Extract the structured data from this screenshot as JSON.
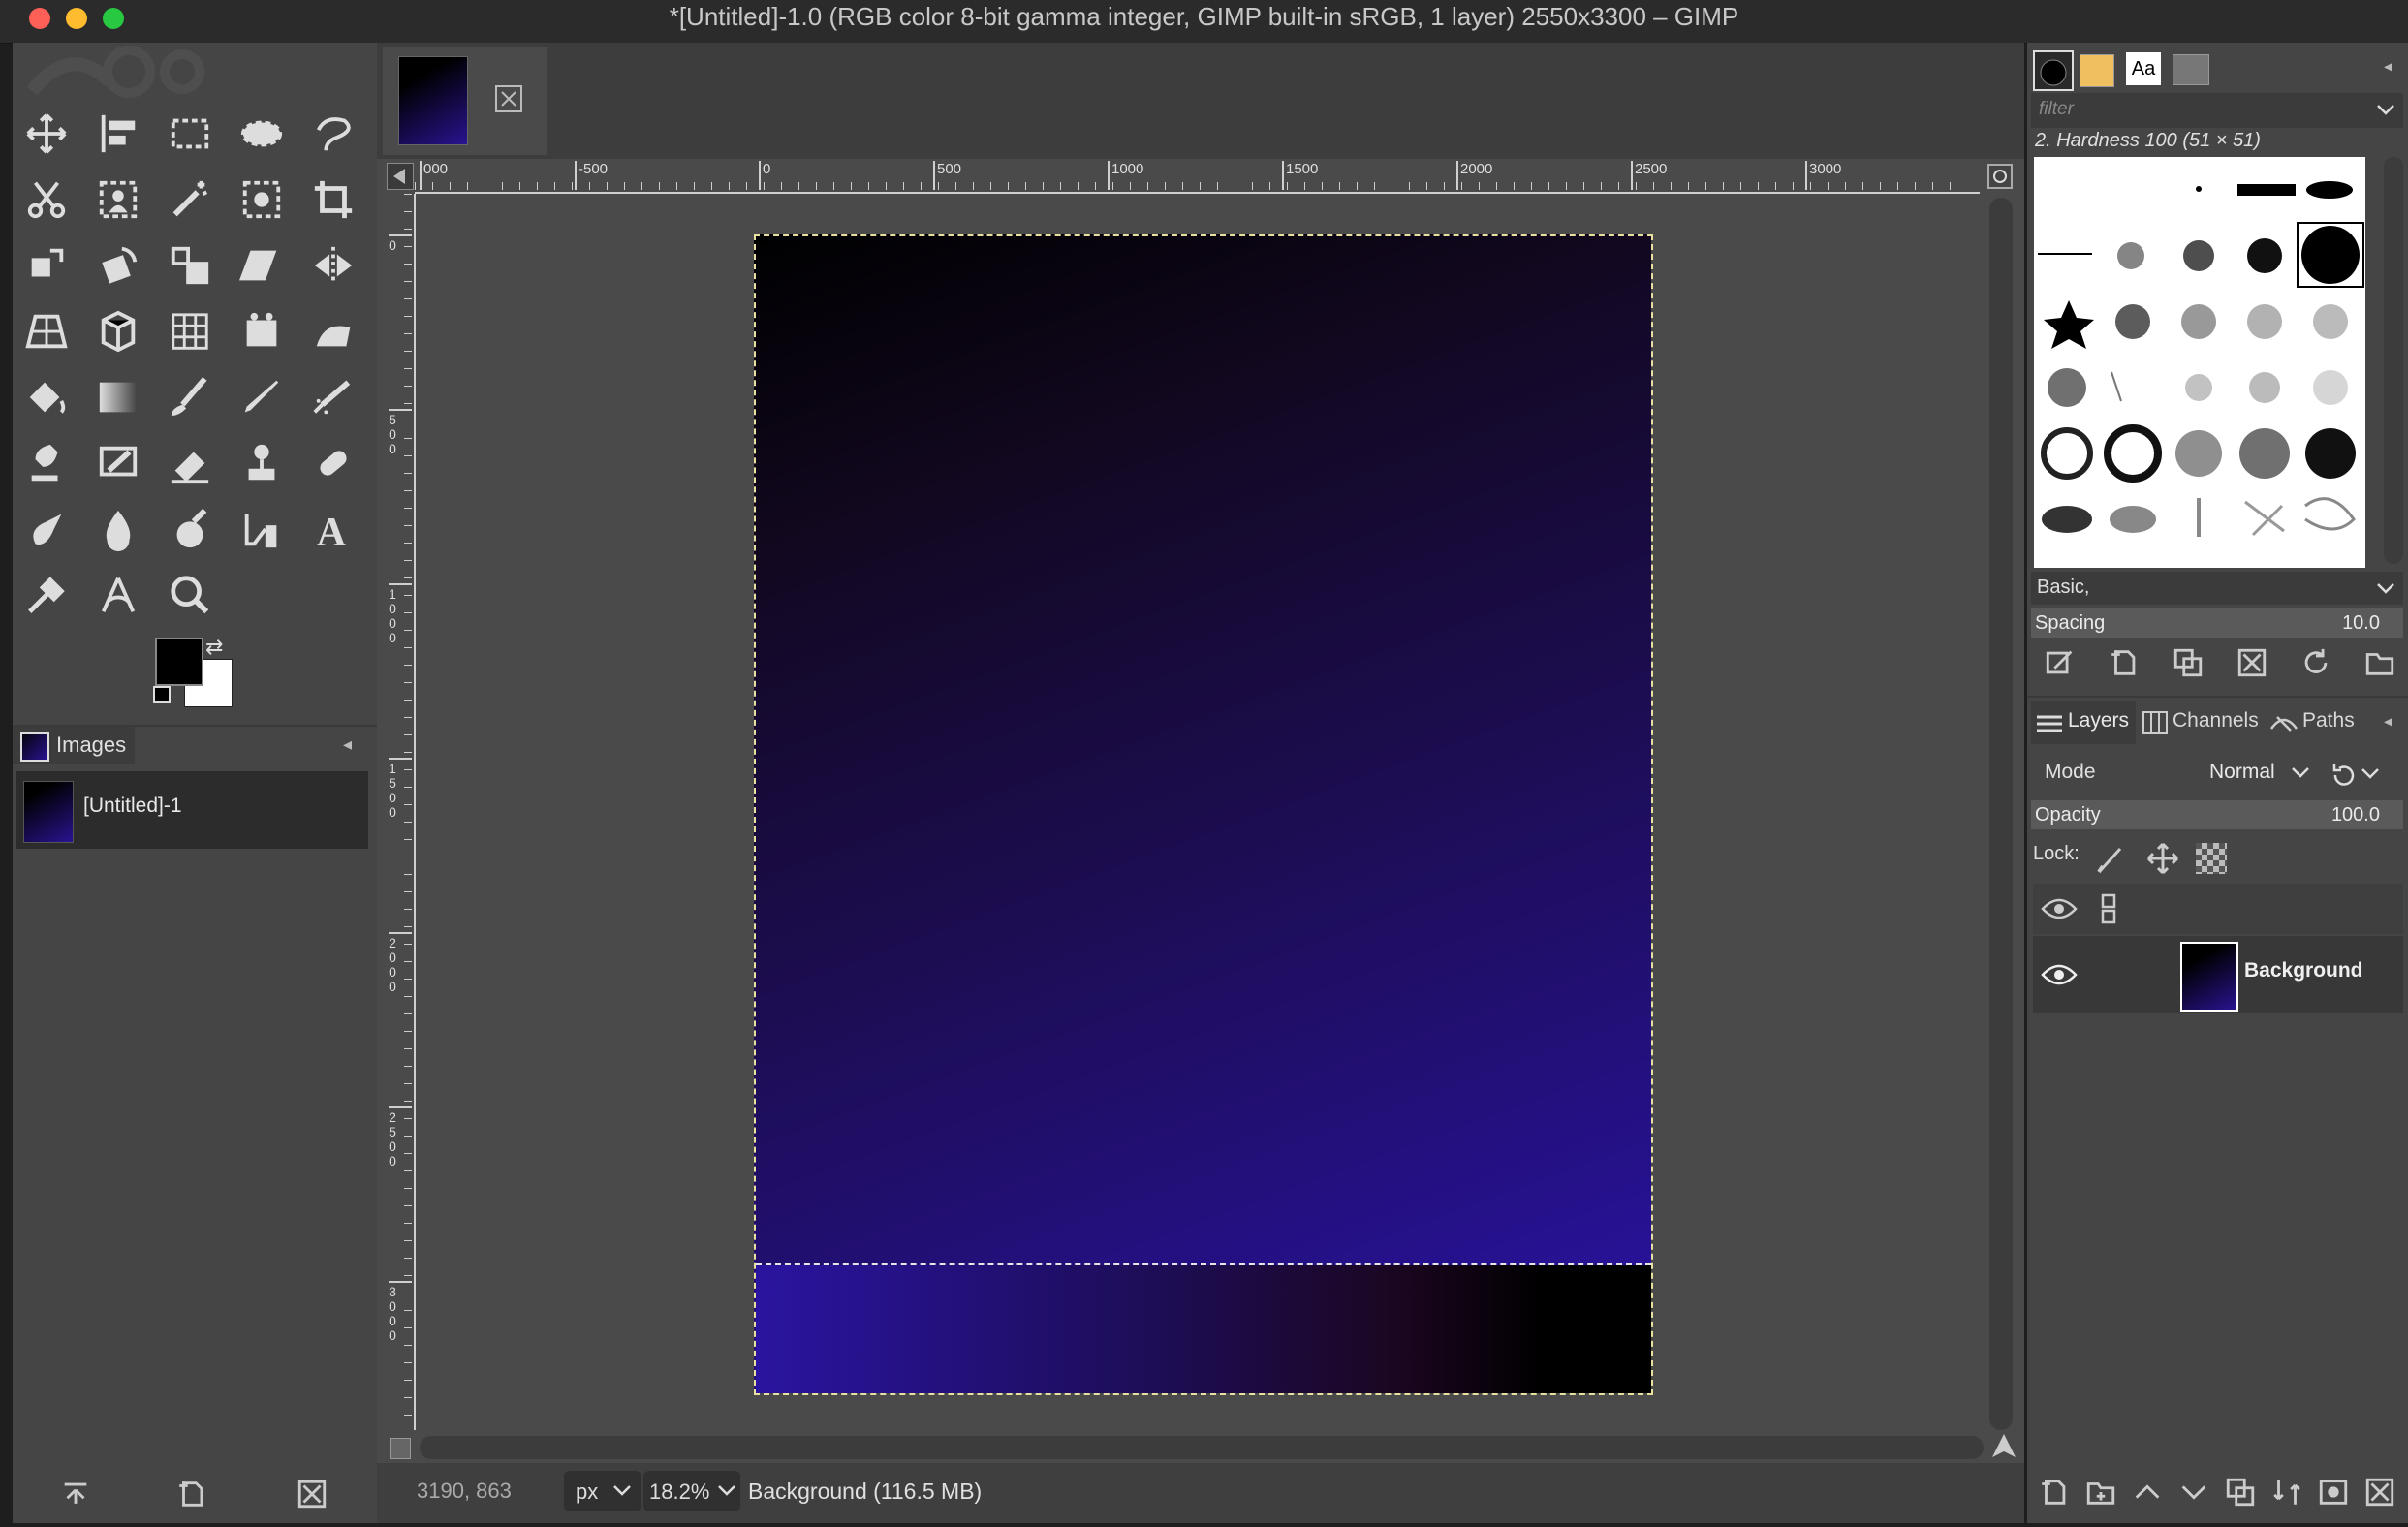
{
  "window": {
    "title": "*[Untitled]-1.0 (RGB color 8-bit gamma integer, GIMP built-in sRGB, 1 layer) 2550x3300 – GIMP",
    "traffic_colors": [
      "#fe5f57",
      "#febc2e",
      "#28c840"
    ]
  },
  "toolbox": {
    "tools": [
      "move-tool",
      "align-tool",
      "rect-select-tool",
      "ellipse-select-tool",
      "free-select-tool",
      "scissors-select-tool",
      "foreground-select-tool",
      "fuzzy-select-tool",
      "select-by-color-tool",
      "crop-tool",
      "unified-transform-tool",
      "rotate-tool",
      "scale-tool",
      "shear-tool",
      "flip-tool",
      "perspective-tool",
      "3d-transform-tool",
      "warp-transform-tool",
      "handle-transform-tool",
      "cage-transform-tool",
      "bucket-fill-tool",
      "gradient-tool",
      "paintbrush-tool",
      "pencil-tool",
      "airbrush-tool",
      "ink-tool",
      "mypaint-brush-tool",
      "eraser-tool",
      "clone-tool",
      "heal-tool",
      "smudge-tool",
      "blur-tool",
      "dodge-burn-tool",
      "path-tool",
      "text-tool",
      "color-picker-tool",
      "measure-tool",
      "zoom-tool"
    ],
    "fg_color": "#000000",
    "bg_color": "#ffffff"
  },
  "images_panel": {
    "tab_label": "Images",
    "items": [
      {
        "label": "[Untitled]-1"
      }
    ]
  },
  "canvas": {
    "ruler_h_labels": [
      "000",
      "-500",
      "0",
      "500",
      "1000",
      "1500",
      "2000",
      "2500",
      "3000"
    ],
    "ruler_v_labels": [
      "0",
      "500",
      "1000",
      "1500",
      "2000",
      "2500",
      "3000"
    ]
  },
  "status": {
    "pointer": "3190, 863",
    "unit": "px",
    "zoom": "18.2%",
    "layer_info": "Background (116.5 MB)"
  },
  "brushes": {
    "filter_placeholder": "filter",
    "selected_brush": "2. Hardness 100 (51 × 51)",
    "tag": "Basic,",
    "spacing_label": "Spacing",
    "spacing_value": "10.0"
  },
  "layers": {
    "tabs": [
      "Layers",
      "Channels",
      "Paths"
    ],
    "mode_label": "Mode",
    "mode_value": "Normal",
    "opacity_label": "Opacity",
    "opacity_value": "100.0",
    "lock_label": "Lock:",
    "items": [
      {
        "name": "Background",
        "visible": true
      }
    ]
  }
}
